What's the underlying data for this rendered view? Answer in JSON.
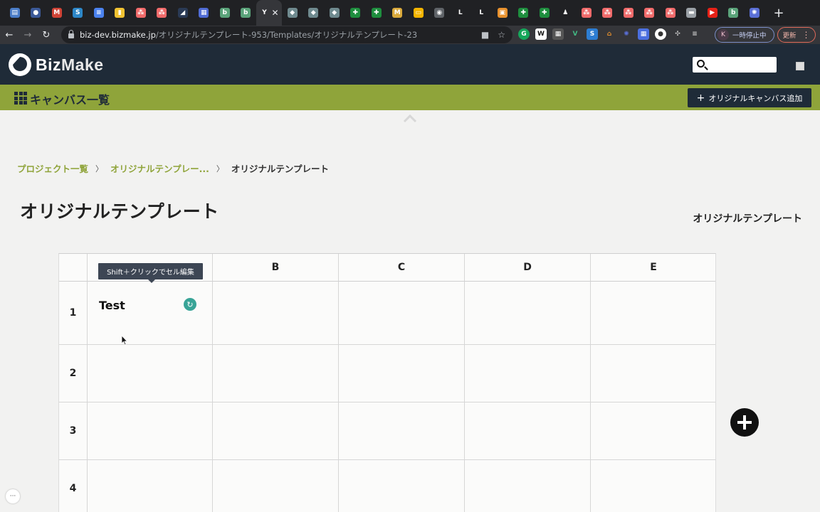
{
  "browser": {
    "tabs": [
      {
        "icon": "doc-icon",
        "glyph": "▤",
        "color": "#4a7cc7"
      },
      {
        "icon": "password-icon",
        "glyph": "●",
        "color": "#3b5998"
      },
      {
        "icon": "gmail-icon",
        "glyph": "M",
        "color": "#d04336"
      },
      {
        "icon": "s-icon",
        "glyph": "S",
        "color": "#2d87c8"
      },
      {
        "icon": "docs-icon",
        "glyph": "≡",
        "color": "#4b82ef"
      },
      {
        "icon": "files-icon",
        "glyph": "▮",
        "color": "#f1c232"
      },
      {
        "icon": "asana-icon",
        "glyph": "⁂",
        "color": "#f06a6a"
      },
      {
        "icon": "asana-icon",
        "glyph": "⁂",
        "color": "#f06a6a"
      },
      {
        "icon": "dark-icon",
        "glyph": "◢",
        "color": "#2a3a55"
      },
      {
        "icon": "board-icon",
        "glyph": "▦",
        "color": "#4f6bd4"
      },
      {
        "icon": "b-icon",
        "glyph": "b",
        "color": "#5aa37a"
      },
      {
        "icon": "b-icon",
        "glyph": "b",
        "color": "#5aa37a"
      },
      {
        "icon": "active-tab-icon",
        "glyph": "Y",
        "color": "#35363a"
      },
      {
        "icon": "cloud-icon",
        "glyph": "◆",
        "color": "#6f8a8f"
      },
      {
        "icon": "cloud-icon",
        "glyph": "◆",
        "color": "#6f8a8f"
      },
      {
        "icon": "cloud-icon",
        "glyph": "◆",
        "color": "#6f8a8f"
      },
      {
        "icon": "sheets-icon",
        "glyph": "✚",
        "color": "#1e8e3e"
      },
      {
        "icon": "sheets-icon",
        "glyph": "✚",
        "color": "#1e8e3e"
      },
      {
        "icon": "miro-icon",
        "glyph": "M",
        "color": "#d9a93b"
      },
      {
        "icon": "slides-icon",
        "glyph": "▭",
        "color": "#f4b400"
      },
      {
        "icon": "globe-icon",
        "glyph": "◉",
        "color": "#5f6368"
      },
      {
        "icon": "l-icon",
        "glyph": "L",
        "color": "#202124"
      },
      {
        "icon": "l-icon",
        "glyph": "L",
        "color": "#202124"
      },
      {
        "icon": "box-icon",
        "glyph": "▣",
        "color": "#e8912d"
      },
      {
        "icon": "sheets-icon",
        "glyph": "✚",
        "color": "#1e8e3e"
      },
      {
        "icon": "sheets-icon",
        "glyph": "✚",
        "color": "#1e8e3e"
      },
      {
        "icon": "person-icon",
        "glyph": "♟",
        "color": "#202124"
      },
      {
        "icon": "asana-icon",
        "glyph": "⁂",
        "color": "#f06a6a"
      },
      {
        "icon": "asana-icon",
        "glyph": "⁂",
        "color": "#f06a6a"
      },
      {
        "icon": "asana-icon",
        "glyph": "⁂",
        "color": "#f06a6a"
      },
      {
        "icon": "asana-icon",
        "glyph": "⁂",
        "color": "#f06a6a"
      },
      {
        "icon": "asana-icon",
        "glyph": "⁂",
        "color": "#f06a6a"
      },
      {
        "icon": "car-icon",
        "glyph": "▬",
        "color": "#9aa0a6"
      },
      {
        "icon": "youtube-icon",
        "glyph": "▶",
        "color": "#e62117"
      },
      {
        "icon": "b-icon",
        "glyph": "b",
        "color": "#5aa37a"
      },
      {
        "icon": "gear-icon",
        "glyph": "✺",
        "color": "#5a6fd6"
      }
    ],
    "new_tab": "+",
    "url_host": "biz-dev.bizmake.jp",
    "url_path": "/オリジナルテンプレート-953/Templates/オリジナルテンプレート-23",
    "pause_avatar": "K",
    "pause_label": "一時停止中",
    "update_label": "更新"
  },
  "header": {
    "logo_biz": "Biz",
    "logo_make": "Make"
  },
  "toolbar": {
    "canvas_list_label": "キャンバス一覧",
    "add_canvas_label": "オリジナルキャンバス追加"
  },
  "breadcrumb": {
    "items": [
      "プロジェクト一覧",
      "オリジナルテンプレー..."
    ],
    "current": "オリジナルテンプレート"
  },
  "page": {
    "title": "オリジナルテンプレート",
    "side_label": "オリジナルテンプレート"
  },
  "canvas": {
    "columns": [
      "",
      "B",
      "C",
      "D",
      "E"
    ],
    "rows": [
      "1",
      "2",
      "3",
      "4"
    ],
    "cell_a1": "Test",
    "tooltip": "Shift＋クリックでセル編集"
  },
  "colors": {
    "brand_dark": "#1f2b38",
    "brand_green": "#8fa43a",
    "accent_teal": "#38a497"
  }
}
